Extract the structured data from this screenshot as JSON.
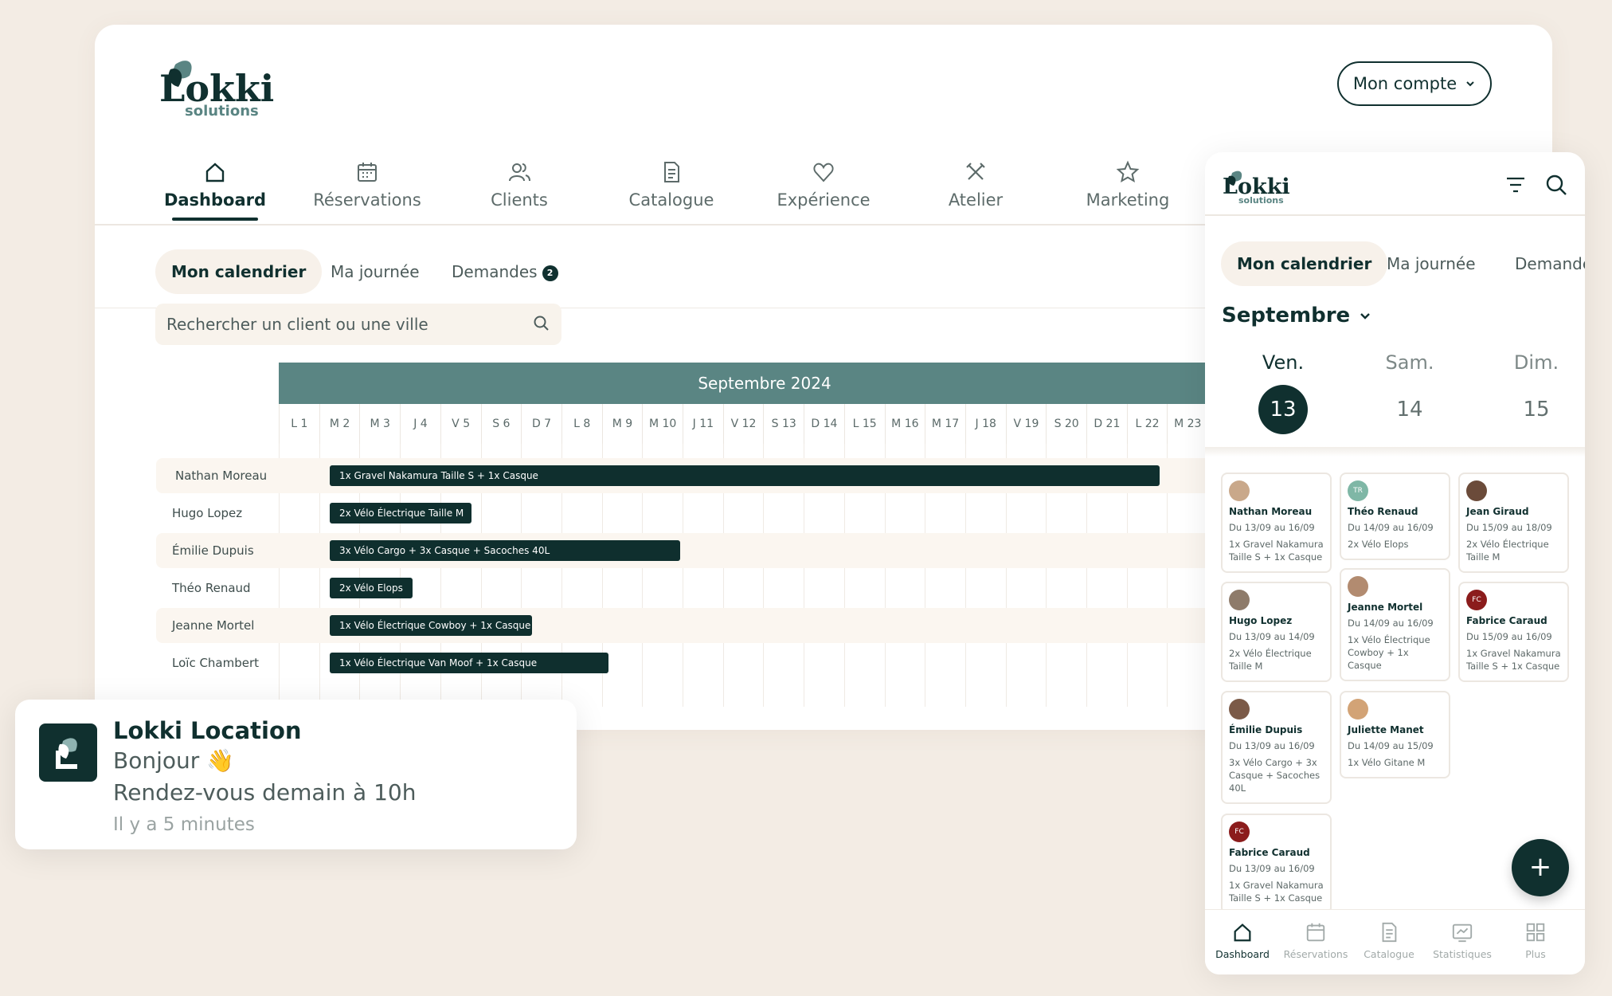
{
  "desktop": {
    "brand": {
      "name": "Lokki",
      "sub": "solutions"
    },
    "account_label": "Mon compte",
    "nav": [
      {
        "label": "Dashboard",
        "icon": "home-icon"
      },
      {
        "label": "Réservations",
        "icon": "calendar-icon"
      },
      {
        "label": "Clients",
        "icon": "users-icon"
      },
      {
        "label": "Catalogue",
        "icon": "document-icon"
      },
      {
        "label": "Expérience",
        "icon": "heart-icon"
      },
      {
        "label": "Atelier",
        "icon": "tools-icon"
      },
      {
        "label": "Marketing",
        "icon": "star-icon"
      }
    ],
    "subtabs": [
      {
        "label": "Mon calendrier"
      },
      {
        "label": "Ma journée"
      },
      {
        "label": "Demandes",
        "badge": "2"
      }
    ],
    "search_placeholder": "Rechercher un client ou une ville",
    "calendar": {
      "month": "Septembre 2024",
      "days": [
        "L 1",
        "M 2",
        "M 3",
        "J 4",
        "V 5",
        "S 6",
        "D 7",
        "L 8",
        "M 9",
        "M 10",
        "J 11",
        "V 12",
        "S 13",
        "D 14",
        "L 15",
        "M 16",
        "M 17",
        "J 18",
        "V 19",
        "S 20",
        "D 21",
        "L 22",
        "M 23"
      ],
      "rows": [
        {
          "name": "Nathan Moreau",
          "booking": "1x Gravel Nakamura Taille S + 1x Casque"
        },
        {
          "name": "Hugo Lopez",
          "booking": "2x Vélo Électrique Taille M"
        },
        {
          "name": "Émilie Dupuis",
          "booking": "3x Vélo Cargo + 3x Casque + Sacoches 40L"
        },
        {
          "name": "Théo Renaud",
          "booking": "2x Vélo Elops"
        },
        {
          "name": "Jeanne Mortel",
          "booking": "1x Vélo Électrique Cowboy + 1x Casque"
        },
        {
          "name": "Loïc Chambert",
          "booking": "1x Vélo Électrique Van Moof + 1x Casque"
        }
      ]
    }
  },
  "notification": {
    "title": "Lokki Location",
    "line1": "Bonjour 👋",
    "line2": "Rendez-vous demain à 10h",
    "time": "Il y a 5 minutes"
  },
  "mobile": {
    "brand": {
      "name": "Lokki",
      "sub": "solutions"
    },
    "tabs": [
      "Mon calendrier",
      "Ma journée",
      "Demandes"
    ],
    "month": "Septembre",
    "days": [
      {
        "name": "Ven.",
        "num": "13"
      },
      {
        "name": "Sam.",
        "num": "14"
      },
      {
        "name": "Dim.",
        "num": "15"
      }
    ],
    "cards": [
      {
        "name": "Nathan Moreau",
        "dates": "Du 13/09 au 16/09",
        "items": "1x Gravel Nakamura Taille S + 1x Casque"
      },
      {
        "name": "Hugo Lopez",
        "dates": "Du 13/09 au 14/09",
        "items": "2x Vélo Électrique Taille M"
      },
      {
        "name": "Émilie Dupuis",
        "dates": "Du 13/09 au 16/09",
        "items": "3x Vélo Cargo + 3x Casque + Sacoches 40L"
      },
      {
        "name": "Fabrice Caraud",
        "dates": "Du 13/09 au 16/09",
        "items": "1x Gravel Nakamura Taille S + 1x Casque",
        "initials": "FC"
      },
      {
        "name": "Théo Renaud",
        "dates": "Du 14/09 au 16/09",
        "items": "2x Vélo Elops",
        "initials": "TR"
      },
      {
        "name": "Jeanne Mortel",
        "dates": "Du 14/09 au 16/09",
        "items": "1x Vélo Électrique Cowboy + 1x Casque"
      },
      {
        "name": "Juliette Manet",
        "dates": "Du 14/09 au 15/09",
        "items": "1x Vélo Gitane M"
      },
      {
        "name": "Jean Giraud",
        "dates": "Du 15/09 au 18/09",
        "items": "2x Vélo Électrique Taille M"
      },
      {
        "name": "Fabrice Caraud",
        "dates": "Du 15/09 au 16/09",
        "items": "1x Gravel Nakamura Taille S + 1x Casque",
        "initials": "FC"
      }
    ],
    "fab_label": "+",
    "bottom_nav": [
      {
        "label": "Dashboard",
        "icon": "home-icon"
      },
      {
        "label": "Réservations",
        "icon": "calendar-icon"
      },
      {
        "label": "Catalogue",
        "icon": "document-icon"
      },
      {
        "label": "Statistiques",
        "icon": "stats-icon"
      },
      {
        "label": "Plus",
        "icon": "grid-icon"
      }
    ]
  },
  "colors": {
    "primary": "#10302f",
    "accent": "#5a8583",
    "background": "#f3ece4",
    "tint": "#f7f1ea"
  }
}
